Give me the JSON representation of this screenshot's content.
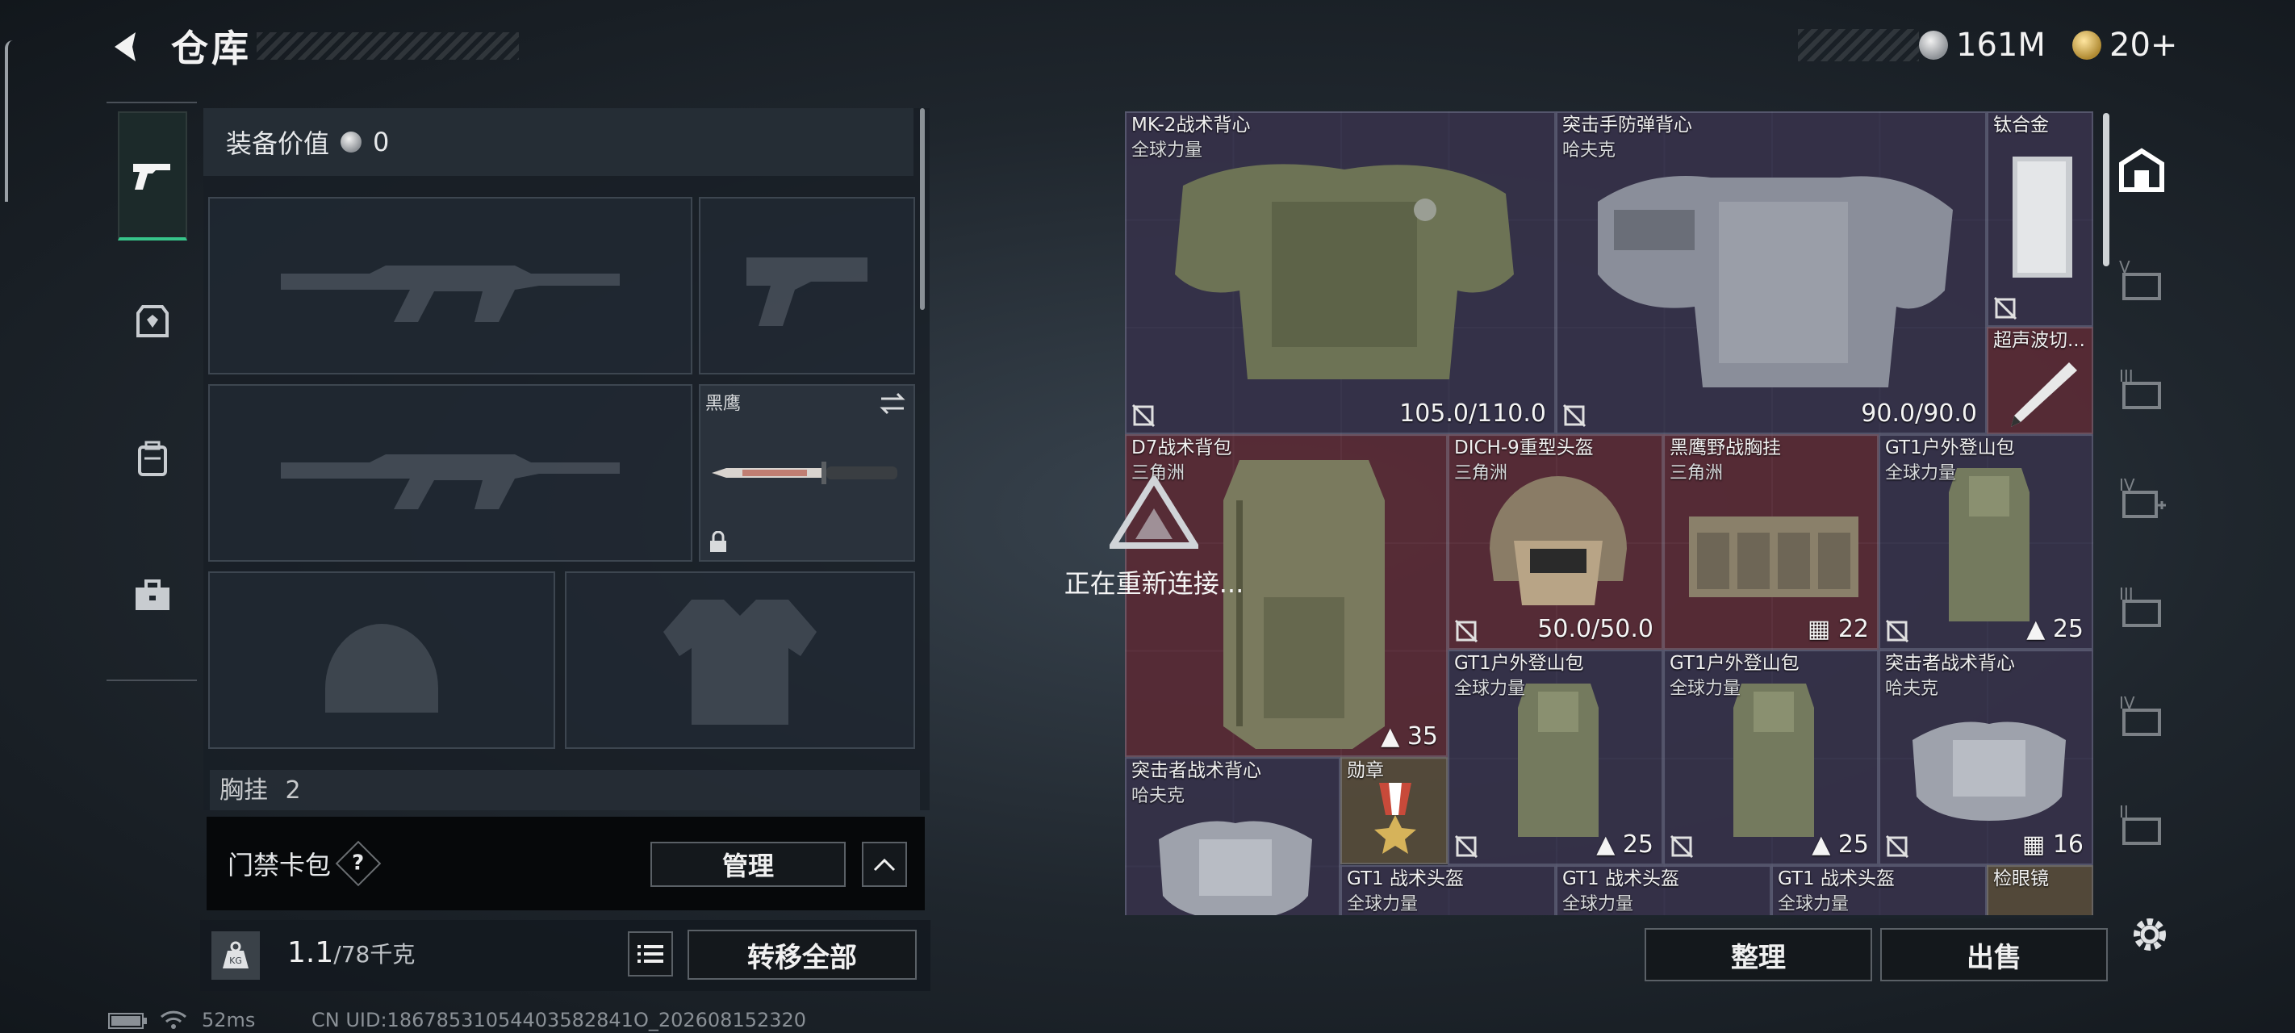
{
  "header": {
    "title": "仓库",
    "currency": [
      {
        "icon": "silver-coin-icon",
        "value": "161M"
      },
      {
        "icon": "gold-coin-icon",
        "value": "20+"
      }
    ]
  },
  "rail": {
    "items": [
      {
        "icon": "pistol-icon",
        "active": true
      },
      {
        "icon": "armor-icon",
        "active": false
      },
      {
        "icon": "backpack-icon",
        "active": false
      },
      {
        "icon": "toolbox-icon",
        "active": false
      }
    ]
  },
  "equipment": {
    "value_label": "装备价值",
    "value": "0",
    "melee_slot_label": "黑鹰",
    "chest_label": "胸挂",
    "chest_count": "2"
  },
  "access_card": {
    "label": "门禁卡包",
    "help": "?",
    "manage_label": "管理"
  },
  "capacity": {
    "value": "1.1",
    "max": "/78千克",
    "transfer_label": "转移全部"
  },
  "status": {
    "ping": "52ms",
    "uid": "CN UID:18678531054403582841O_202608152320"
  },
  "overlay": {
    "reconnect_text": "正在重新连接..."
  },
  "grid": {
    "items": [
      {
        "name": "MK-2战术背心",
        "sub": "全球力量",
        "value": "105.0/110.0"
      },
      {
        "name": "突击手防弹背心",
        "sub": "哈夫克",
        "value": "90.0/90.0"
      },
      {
        "name": "钛合金",
        "sub": "",
        "value": ""
      },
      {
        "name": "超声波切...",
        "sub": "",
        "value": ""
      },
      {
        "name": "D7战术背包",
        "sub": "三角洲",
        "value": "35"
      },
      {
        "name": "DICH-9重型头盔",
        "sub": "三角洲",
        "value": "50.0/50.0"
      },
      {
        "name": "黑鹰野战胸挂",
        "sub": "三角洲",
        "value": "22"
      },
      {
        "name": "GT1户外登山包",
        "sub": "全球力量",
        "value": "25"
      },
      {
        "name": "GT1户外登山包",
        "sub": "全球力量",
        "value": "25"
      },
      {
        "name": "GT1户外登山包",
        "sub": "全球力量",
        "value": "25"
      },
      {
        "name": "突击者战术背心",
        "sub": "哈夫克",
        "value": "16"
      },
      {
        "name": "突击者战术背心",
        "sub": "哈夫克",
        "value": ""
      },
      {
        "name": "勋章",
        "sub": "",
        "value": ""
      },
      {
        "name": "GT1 战术头盔",
        "sub": "全球力量",
        "value": ""
      },
      {
        "name": "GT1 战术头盔",
        "sub": "全球力量",
        "value": ""
      },
      {
        "name": "GT1 战术头盔",
        "sub": "全球力量",
        "value": ""
      },
      {
        "name": "检眼镜",
        "sub": "",
        "value": ""
      }
    ]
  },
  "actions": {
    "sort_label": "整理",
    "sell_label": "出售"
  },
  "right_rail": {
    "items": [
      {
        "icon": "warehouse-icon",
        "label": ""
      },
      {
        "icon": "tab-v-icon",
        "label": "V"
      },
      {
        "icon": "tab-iii-icon",
        "label": "III"
      },
      {
        "icon": "tab-iv-plus-icon",
        "label": "IV"
      },
      {
        "icon": "tab-iii-b-icon",
        "label": "III"
      },
      {
        "icon": "tab-iv-b-icon",
        "label": "IV"
      },
      {
        "icon": "tab-ii-icon",
        "label": "II"
      }
    ]
  }
}
